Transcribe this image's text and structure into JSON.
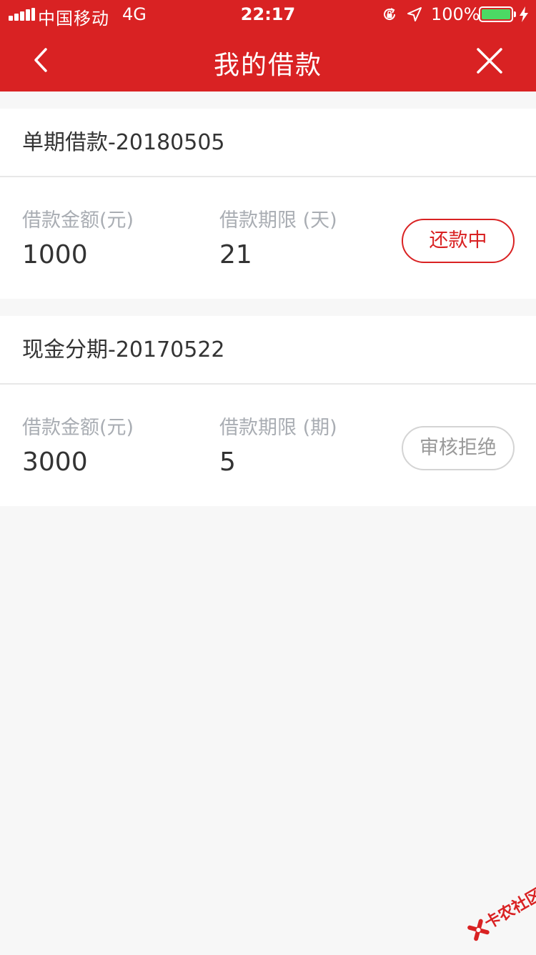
{
  "status_bar": {
    "carrier": "中国移动",
    "network": "4G",
    "time": "22:17",
    "battery_percent": "100%"
  },
  "nav": {
    "title": "我的借款"
  },
  "loans": [
    {
      "title": "单期借款-20180505",
      "amount_label": "借款金额(元)",
      "amount": "1000",
      "term_label": "借款期限 (天)",
      "term": "21",
      "status": "还款中"
    },
    {
      "title": "现金分期-20170522",
      "amount_label": "借款金额(元)",
      "amount": "3000",
      "term_label": "借款期限 (期)",
      "term": "5",
      "status": "审核拒绝"
    }
  ],
  "watermark": {
    "text": "卡农社区"
  },
  "colors": {
    "brand_red": "#d92223",
    "battery_green": "#4cd964",
    "label_gray": "#a9adb3"
  }
}
